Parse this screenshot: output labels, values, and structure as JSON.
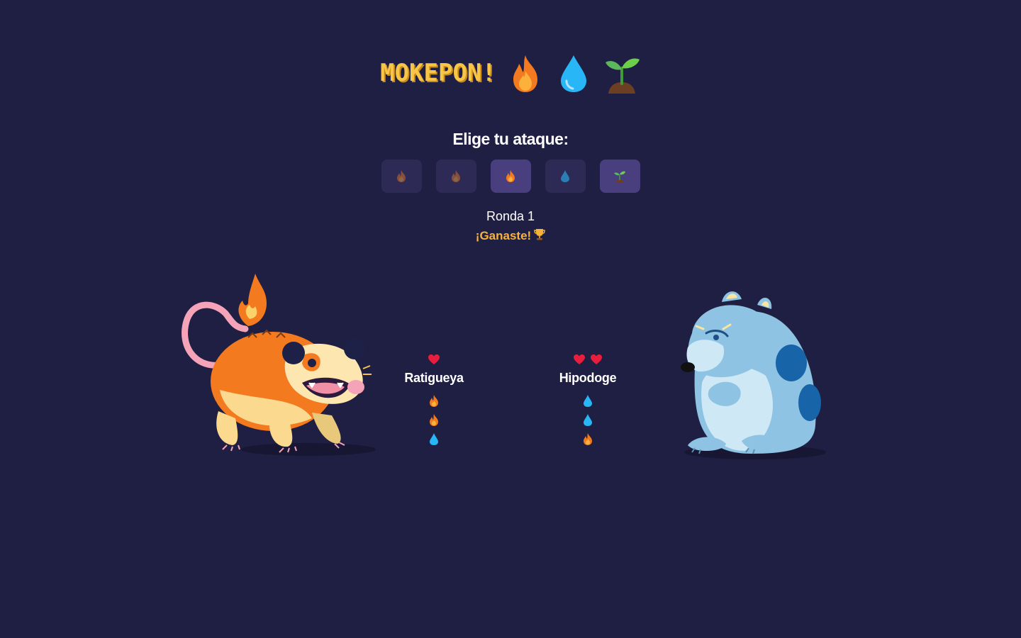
{
  "header": {
    "title": "MOKEPON!",
    "icons": [
      "fire-icon",
      "water-icon",
      "plant-icon"
    ]
  },
  "attack_panel": {
    "prompt": "Elige tu ataque:",
    "buttons": [
      {
        "icon": "fire-icon",
        "state": "used"
      },
      {
        "icon": "fire-icon",
        "state": "used"
      },
      {
        "icon": "fire-icon",
        "state": "active"
      },
      {
        "icon": "water-icon",
        "state": "dim"
      },
      {
        "icon": "plant-icon",
        "state": "active"
      }
    ]
  },
  "status": {
    "round": "Ronda 1",
    "result": "¡Ganaste!",
    "result_icon": "trophy-icon"
  },
  "player": {
    "name": "Ratigueya",
    "lives": 1,
    "attacks": [
      "fire-icon",
      "fire-icon",
      "water-icon"
    ]
  },
  "enemy": {
    "name": "Hipodoge",
    "lives": 2,
    "attacks": [
      "water-icon",
      "water-icon",
      "fire-icon"
    ]
  },
  "colors": {
    "background": "#1f1f43",
    "title": "#f7c548",
    "result": "#f7b23b",
    "button": "#2d2a55",
    "button_active": "#4a3f7e"
  }
}
